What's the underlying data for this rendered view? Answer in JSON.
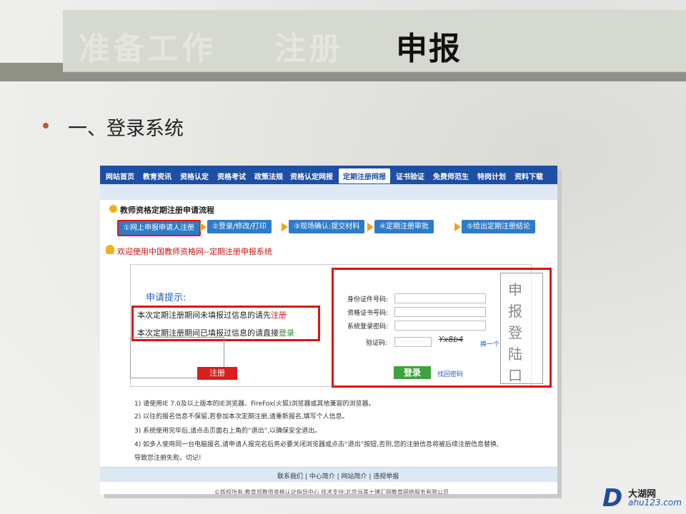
{
  "slide": {
    "title_faded_1": "准备工作",
    "title_faded_2": "注册",
    "title_active": "申报",
    "heading": "一、登录系统"
  },
  "site": {
    "nav": [
      "网站首页",
      "教育资讯",
      "资格认定",
      "资格考试",
      "政策法规",
      "资格认定网报",
      "定期注册网报",
      "证书验证",
      "免费师范生",
      "特岗计划",
      "资料下载"
    ],
    "flow_title": "教师资格定期注册申请流程",
    "steps": [
      "①网上申报申请人注册",
      "②登录/修改/打印",
      "③现场确认:提交材料",
      "④定期注册审批",
      "⑤给出定期注册结论"
    ],
    "welcome": "欢迎使用中国教师资格网--定期注册申报系统",
    "tips_title": "申请提示:",
    "tip1_text": "本次定期注册期间未填报过信息的请先",
    "tip1_link": "注册",
    "tip2_text": "本次定期注册期间已填报过信息的请直接",
    "tip2_link": "登录",
    "register_button": "注册",
    "fields": {
      "id_number": "身份证件号码:",
      "cert_number": "资格证书号码:",
      "password": "系统登录密码:",
      "captcha": "验证码:"
    },
    "captcha_text": "Yx8b4",
    "refresh_link": "换一个",
    "login_button": "登录",
    "forgot_link": "找回密码",
    "annotation": "申报登陆口",
    "notes": [
      "1) 请使用IE 7.0及以上版本的IE浏览器、FireFox(火狐)浏览器或其他兼容的浏览器。",
      "2) 以往的报名信息不保留,若参加本次定期注册,请重新报名,填写个人信息。",
      "3) 系统使用完毕后,请点击页面右上角的“退出”,以确保安全退出。",
      "4) 如多人使用同一台电脑报名,请申请人报完名后务必要关闭浏览器或点击“退出”按钮,否则,您的注册信息将被后续注册信息替换,",
      "导致您注册失败。切记!"
    ],
    "footer_links": "联系我们 | 中心简介 | 网站简介 | 违规举报",
    "footer_copy": "©版权所有:教育部教师资格认证指导中心 技术支持:北京当其十博汇网教育网络服务有限公司"
  },
  "logo": {
    "letter": "D",
    "cn": "大湖网",
    "url": "ahu123.com"
  }
}
